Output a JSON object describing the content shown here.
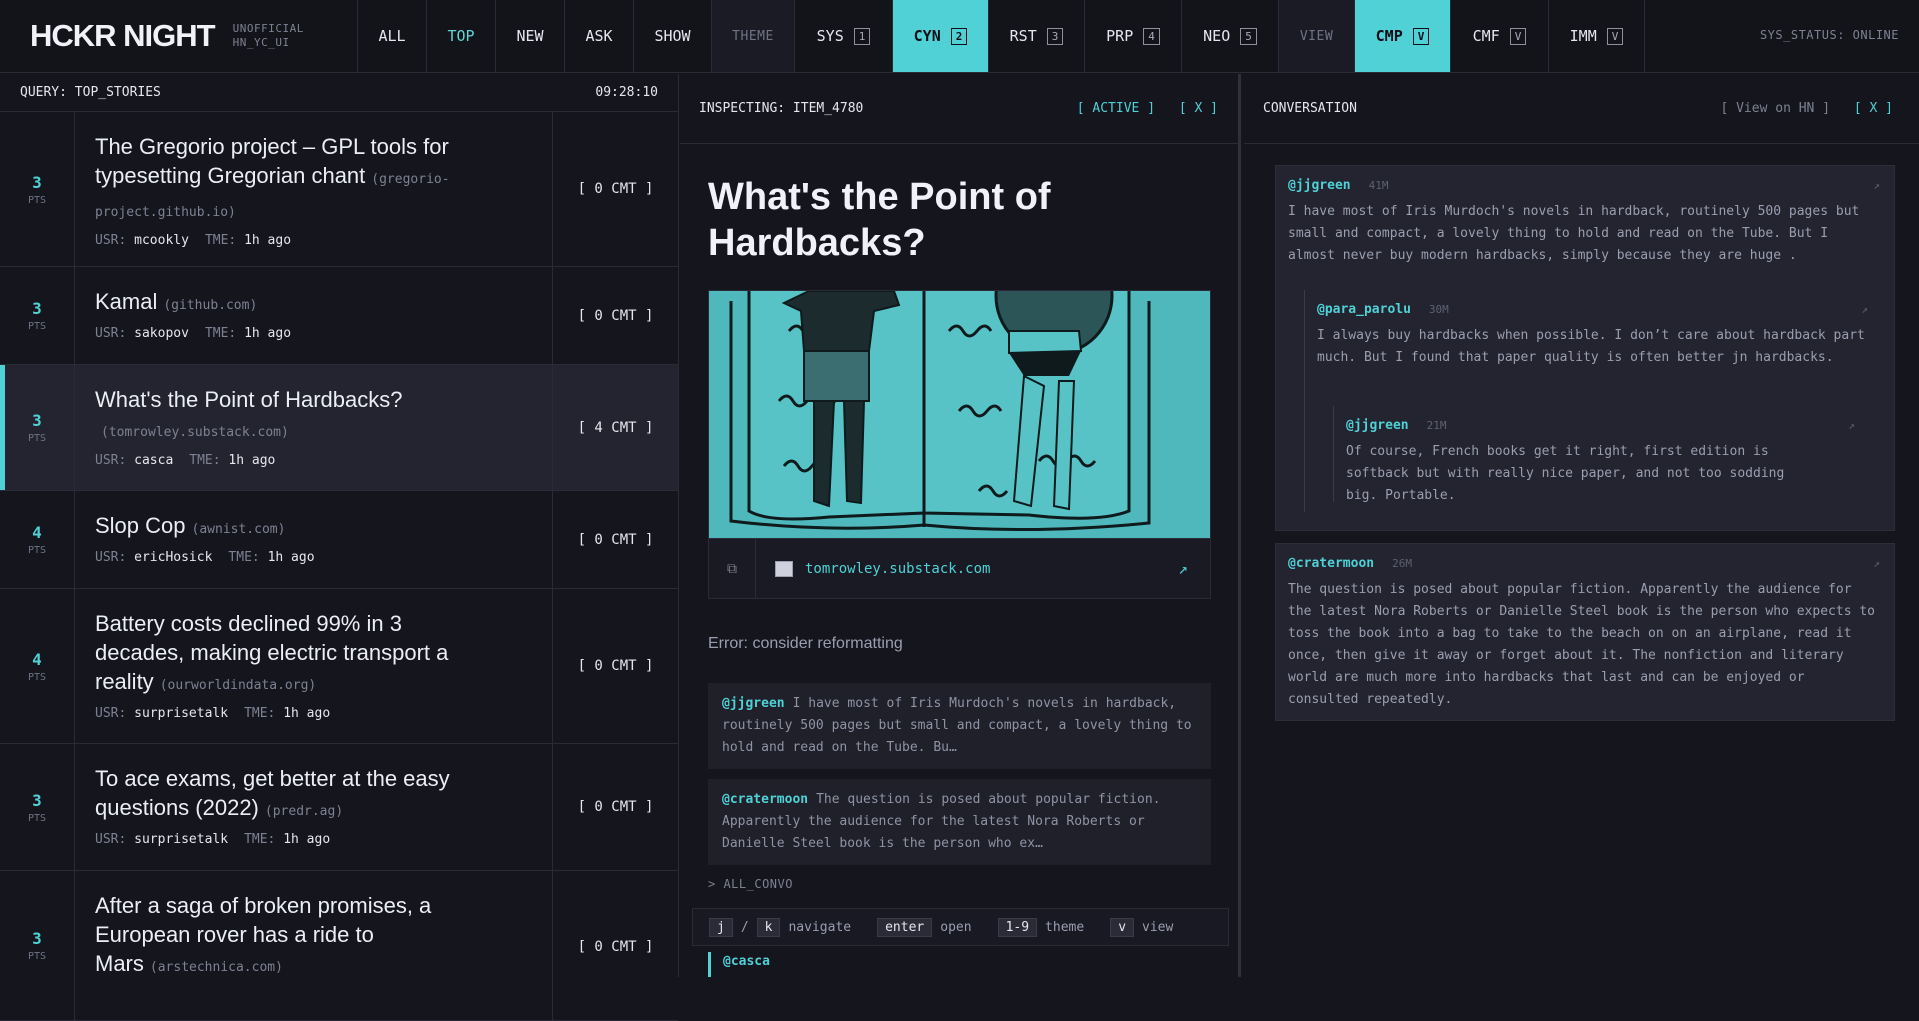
{
  "brand": {
    "logo": "HCKR NIGHT",
    "sub1": "UNOFFICIAL",
    "sub2": "HN_YC_UI"
  },
  "nav": {
    "all": "ALL",
    "top": "TOP",
    "new": "NEW",
    "ask": "ASK",
    "show": "SHOW",
    "theme_label": "THEME",
    "themes": [
      {
        "label": "SYS",
        "key": "1"
      },
      {
        "label": "CYN",
        "key": "2"
      },
      {
        "label": "RST",
        "key": "3"
      },
      {
        "label": "PRP",
        "key": "4"
      },
      {
        "label": "NEO",
        "key": "5"
      }
    ],
    "view_label": "VIEW",
    "views": [
      {
        "label": "CMP",
        "key": "V"
      },
      {
        "label": "CMF",
        "key": "V"
      },
      {
        "label": "IMM",
        "key": "V"
      }
    ],
    "sys_status": "SYS_STATUS: ONLINE"
  },
  "list": {
    "query": "QUERY: TOP_STORIES",
    "time": "09:28:10",
    "pts_label": "PTS",
    "usr_label": "USR:",
    "tme_label": "TME:",
    "stories": [
      {
        "points": "3",
        "title": "The Gregorio project – GPL tools for typesetting Gregorian chant",
        "domain": "(gregorio-project.github.io)",
        "user": "mcookly",
        "time": "1h ago",
        "comments": "[ 0 CMT ]"
      },
      {
        "points": "3",
        "title": "Kamal",
        "domain": "(github.com)",
        "user": "sakopov",
        "time": "1h ago",
        "comments": "[ 0 CMT ]"
      },
      {
        "points": "3",
        "title": "What's the Point of Hardbacks?",
        "domain": "(tomrowley.substack.com)",
        "user": "casca",
        "time": "1h ago",
        "comments": "[ 4 CMT ]"
      },
      {
        "points": "4",
        "title": "Slop Cop",
        "domain": "(awnist.com)",
        "user": "ericHosick",
        "time": "1h ago",
        "comments": "[ 0 CMT ]"
      },
      {
        "points": "4",
        "title": "Battery costs declined 99% in 3 decades, making electric transport a reality",
        "domain": "(ourworldindata.org)",
        "user": "surprisetalk",
        "time": "1h ago",
        "comments": "[ 0 CMT ]"
      },
      {
        "points": "3",
        "title": "To ace exams, get better at the easy questions (2022)",
        "domain": "(predr.ag)",
        "user": "surprisetalk",
        "time": "1h ago",
        "comments": "[ 0 CMT ]"
      },
      {
        "points": "3",
        "title": "After a saga of broken promises, a European rover has a ride to Mars",
        "domain": "(arstechnica.com)",
        "user": "",
        "time": "",
        "comments": "[ 0 CMT ]"
      }
    ]
  },
  "inspect": {
    "header": "INSPECTING: ITEM_4780",
    "active": "[ ACTIVE ]",
    "close": "[ X ]",
    "title": "What's the Point of Hardbacks?",
    "url": "tomrowley.substack.com",
    "error": "Error: consider reformatting",
    "previews": [
      {
        "user": "@jjgreen",
        "text": "I have most of Iris Murdoch's novels in hardback, routinely 500 pages but small and compact, a lovely thing to hold and read on the Tube. Bu…"
      },
      {
        "user": "@cratermoon",
        "text": "The question is posed about popular fiction. Apparently the audience for the latest Nora Roberts or Danielle Steel book is the person who ex…"
      }
    ],
    "all_convo": "> ALL_CONVO",
    "shortcuts": {
      "j": "j",
      "slash": "/",
      "k": "k",
      "navigate": "navigate",
      "enter": "enter",
      "open": "open",
      "nums": "1-9",
      "theme": "theme",
      "v": "v",
      "view": "view"
    },
    "bottom_user": "@casca"
  },
  "conversation": {
    "header": "CONVERSATION",
    "view_on_hn": "[ View on HN ]",
    "close": "[ X ]",
    "comments": [
      {
        "user": "@jjgreen",
        "time": "41M",
        "text": "I have most of Iris Murdoch's novels in hardback, routinely 500 pages but small and compact, a lovely thing to hold and read on the Tube. But I almost never buy modern hardbacks, simply because they are huge ."
      },
      {
        "user": "@para_parolu",
        "time": "30M",
        "text": "I always buy hardbacks when possible. I don’t care about hardback part much. But I found that paper quality is often better jn hardbacks."
      },
      {
        "user": "@jjgreen",
        "time": "21M",
        "text": "Of course, French books get it right, first edition is softback but with really nice paper, and not too sodding big. Portable."
      },
      {
        "user": "@cratermoon",
        "time": "26M",
        "text": "The question is posed about popular fiction. Apparently the audience for the latest Nora Roberts or Danielle Steel book is the person who expects to toss the book into a bag to take to the beach on on an airplane, read it once, then give it away or forget about it. The nonfiction and literary world are much more into hardbacks that last and can be enjoyed or consulted repeatedly."
      }
    ],
    "link_glyph": "↗"
  },
  "colors": {
    "accent": "#4fd1d6",
    "bg": "#15151d",
    "panel": "#23242f"
  }
}
